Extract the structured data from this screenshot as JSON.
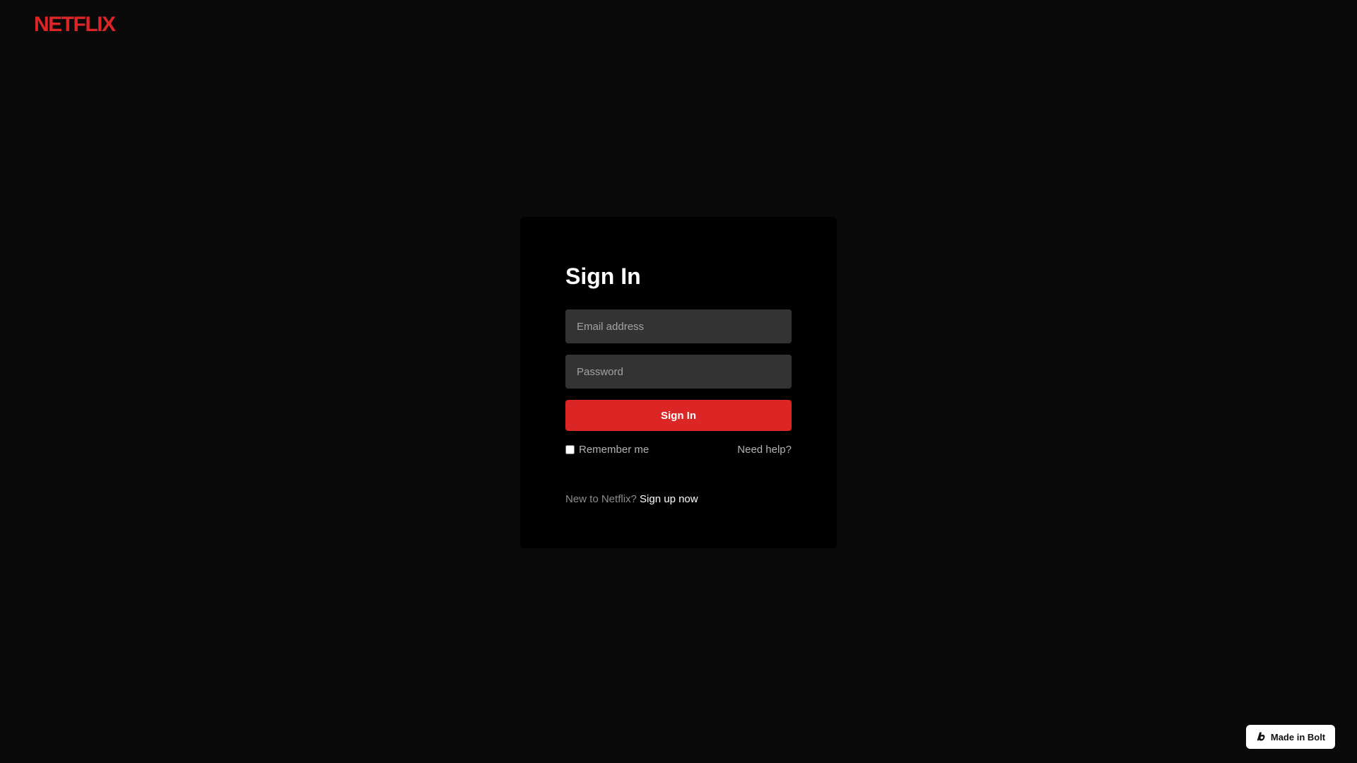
{
  "brand": {
    "logo_text": "NETFLIX",
    "accent_color": "#dc2626"
  },
  "signin": {
    "title": "Sign In",
    "email_placeholder": "Email address",
    "password_placeholder": "Password",
    "submit_label": "Sign In",
    "remember_label": "Remember me",
    "remember_checked": false,
    "help_link": "Need help?",
    "new_prompt": "New to Netflix?",
    "signup_link": "Sign up now"
  },
  "badge": {
    "label": "Made in Bolt",
    "icon": "bolt-logo-icon"
  }
}
